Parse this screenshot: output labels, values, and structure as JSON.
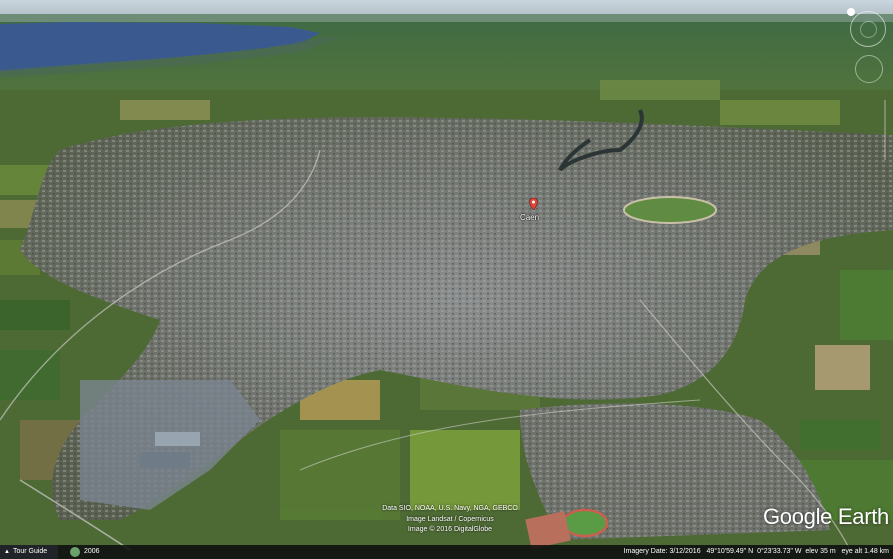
{
  "map": {
    "place_label": "Caen",
    "attribution_lines": [
      "Data SIO, NOAA, U.S. Navy, NGA, GEBCO",
      "Image Landsat / Copernicus",
      "Image © 2016 DigitalGlobe"
    ],
    "logo": "Google Earth"
  },
  "status": {
    "tour_guide_label": "Tour Guide",
    "historical_year": "2006",
    "imagery_date": "Imagery Date: 3/12/2016",
    "latitude": "49°10'59.49\" N",
    "longitude": "0°23'33.73\" W",
    "elevation": "elev   35 m",
    "eye_alt": "eye alt   1.48 km"
  },
  "icons": {
    "marker": "placemark-pin-icon",
    "look": "look-joystick-icon",
    "move": "move-joystick-icon",
    "zoom": "zoom-slider-icon",
    "tour": "chevron-up-icon",
    "history": "historical-imagery-icon"
  },
  "colors": {
    "sea": "#3a5a8f",
    "urban": "#7c8080",
    "field": "#4c6e33"
  }
}
